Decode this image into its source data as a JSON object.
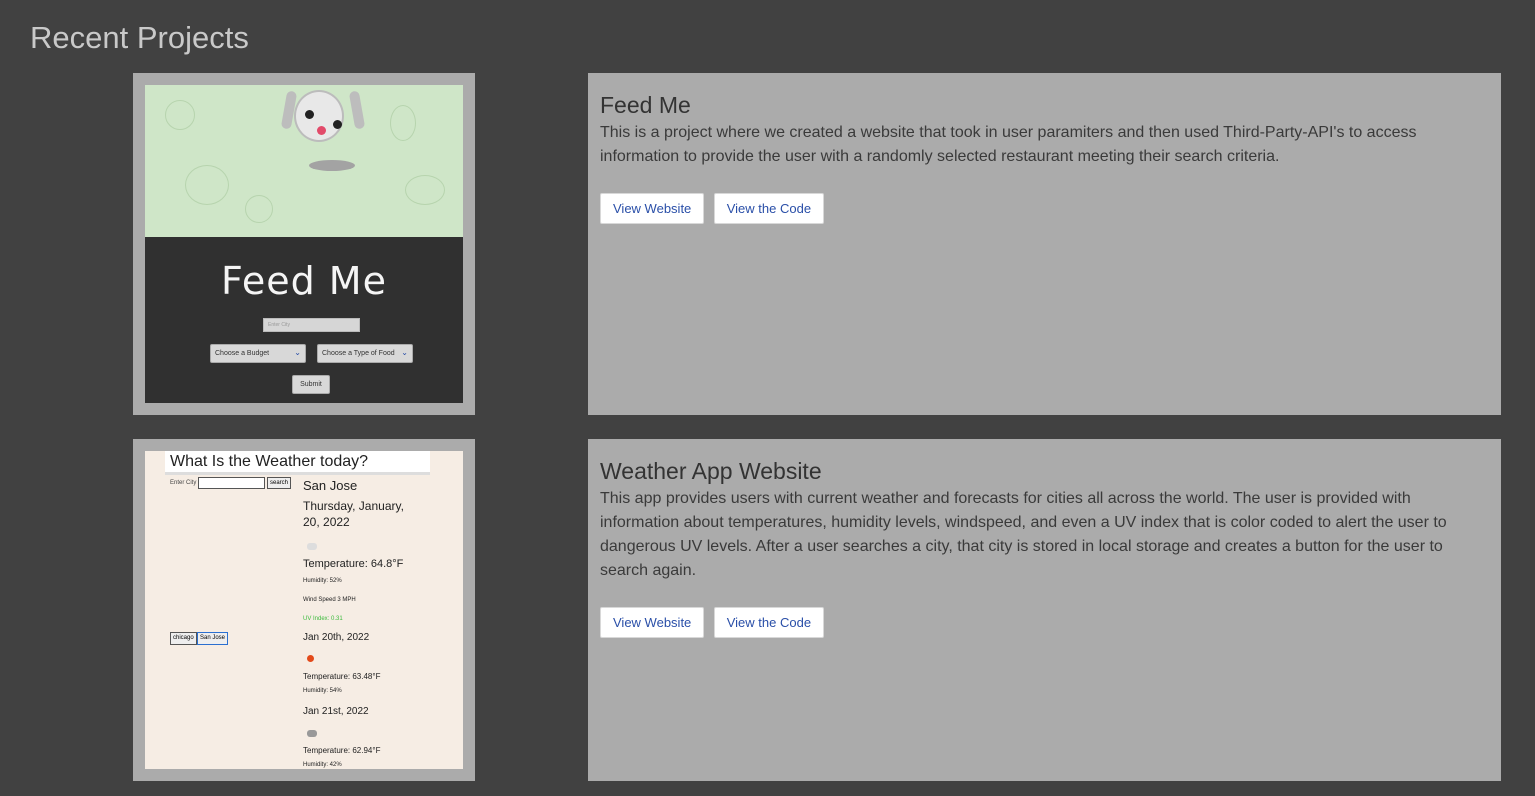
{
  "section": {
    "title": "Recent Projects"
  },
  "projects": [
    {
      "title": "Feed Me",
      "description": "This is a project where we created a website that took in user paramiters and then used Third-Party-API's to access information to provide the user with a randomly selected restaurant meeting their search criteria.",
      "view_website_label": "View Website",
      "view_code_label": "View the Code",
      "thumbnail": {
        "heading": "Feed Me",
        "city_placeholder": "Enter City",
        "budget_select": "Choose a Budget",
        "food_select": "Choose a Type of Food",
        "submit_label": "Submit"
      }
    },
    {
      "title": "Weather App Website",
      "description": "This app provides users with current weather and forecasts for cities all across the world. The user is provided with information about temperatures, humidity levels, windspeed, and even a UV index that is color coded to alert the user to dangerous UV levels. After a user searches a city, that city is stored in local storage and creates a button for the user to search again.",
      "view_website_label": "View Website",
      "view_code_label": "View the Code",
      "thumbnail": {
        "heading": "What Is the Weather today?",
        "enter_city_label": "Enter City",
        "search_label": "search",
        "city": "San Jose",
        "date": "Thursday, January, 20, 2022",
        "temperature": "Temperature: 64.8°F",
        "humidity": "Humidity: 52%",
        "wind": "Wind Speed 3 MPH",
        "uv": "UV Index: 0.31",
        "history": [
          "chicago",
          "San Jose"
        ],
        "forecast": [
          {
            "date": "Jan 20th, 2022",
            "temperature": "Temperature: 63.48°F",
            "humidity": "Humidity: 54%"
          },
          {
            "date": "Jan 21st, 2022",
            "temperature": "Temperature: 62.94°F",
            "humidity": "Humidity: 42%"
          }
        ]
      }
    }
  ],
  "colors": {
    "page_bg": "#414141",
    "card_bg": "#ababab",
    "link": "#2a4fa8",
    "uv_good": "#3dbb3d"
  }
}
